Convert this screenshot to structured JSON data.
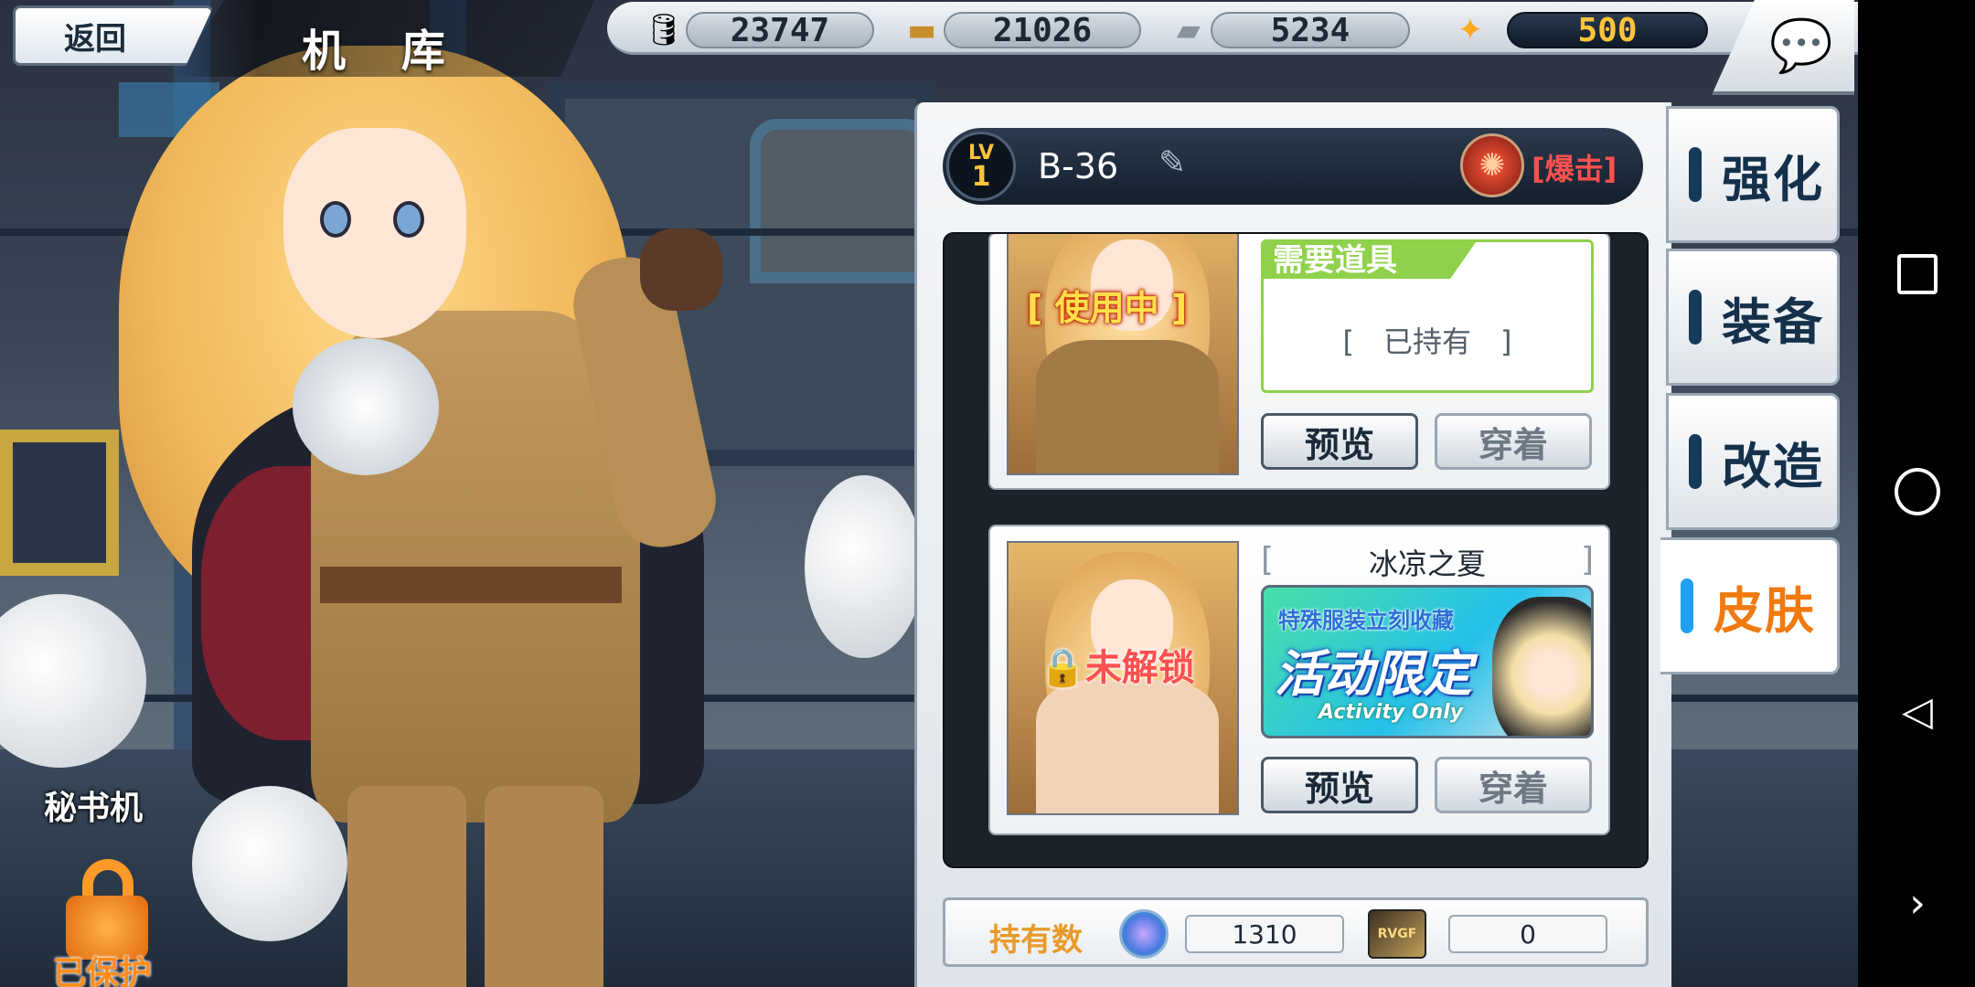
{
  "top": {
    "back_label": "返回",
    "title": "机 库",
    "resources": [
      {
        "icon": "fuel-icon",
        "value": "23747"
      },
      {
        "icon": "ammo-icon",
        "value": "21026"
      },
      {
        "icon": "steel-icon",
        "value": "5234"
      },
      {
        "icon": "medal-icon",
        "value": "500"
      }
    ],
    "chat_icon": "chat-icon"
  },
  "secretary": {
    "label": "秘书机",
    "lock_label": "已保护"
  },
  "header": {
    "lv_label": "LV",
    "lv_value": "1",
    "ship_name": "B-36",
    "trait": "[爆击]"
  },
  "skins": [
    {
      "badge": "[ 使用中 ]",
      "req_title": "需要道具",
      "req_value": "[　已持有　]",
      "preview": "预览",
      "wear": "穿着"
    },
    {
      "badge": "未解锁",
      "name": "冰凉之夏",
      "bracket_l": "[",
      "bracket_r": "]",
      "event_top": "特殊服装立刻收藏",
      "event_main": "活动限定",
      "event_sub": "Activity Only",
      "preview": "预览",
      "wear": "穿着"
    }
  ],
  "footer": {
    "label": "持有数",
    "gem_value": "1310",
    "ticket_text": "RVGF",
    "ticket_value": "0"
  },
  "tabs": [
    {
      "label": "强化",
      "active": false
    },
    {
      "label": "装备",
      "active": false
    },
    {
      "label": "改造",
      "active": false
    },
    {
      "label": "皮肤",
      "active": true
    }
  ],
  "colors": {
    "accent": "#f07a10",
    "active_mark": "#1fa0f0",
    "req_green": "#8fd14a",
    "crit_red": "#ff5050"
  }
}
